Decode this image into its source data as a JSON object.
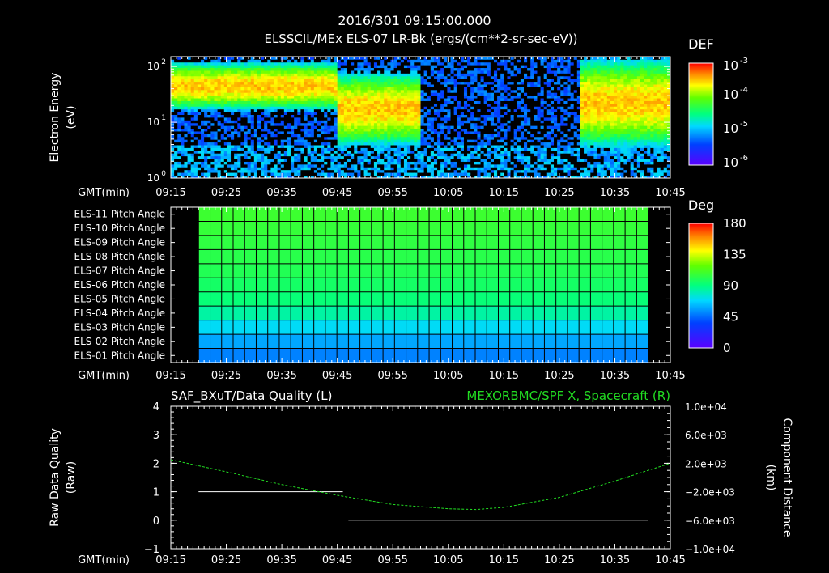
{
  "header": {
    "title": "2016/301 09:15:00.000",
    "subtitle": "ELSSCIL/MEx ELS-07 LR-Bk  (ergs/(cm**2-sr-sec-eV))"
  },
  "colors": {
    "background": "#000000",
    "axes": "#ffffff",
    "quality_line": "#ffffff",
    "spacecraft_line": "#22dd22",
    "right_title": "#22dd22"
  },
  "chart_data": [
    {
      "type": "heatmap",
      "name": "energy-spectrogram",
      "ylabel": "Electron Energy",
      "yunit": "(eV)",
      "xlabel": "GMT(min)",
      "x_ticks": [
        "09:15",
        "09:25",
        "09:35",
        "09:45",
        "09:55",
        "10:05",
        "10:15",
        "10:25",
        "10:35",
        "10:45"
      ],
      "y_scale": "log",
      "ylim": [
        1,
        150
      ],
      "y_ticks": [
        {
          "base": "10",
          "exp": "0",
          "value": 1
        },
        {
          "base": "10",
          "exp": "1",
          "value": 10
        },
        {
          "base": "10",
          "exp": "2",
          "value": 100
        }
      ],
      "colorbar": {
        "label": "DEF",
        "scale": "log",
        "ticks": [
          {
            "base": "10",
            "exp": "-3",
            "value": 0.001
          },
          {
            "base": "10",
            "exp": "-4",
            "value": 0.0001
          },
          {
            "base": "10",
            "exp": "-5",
            "value": 1e-05
          },
          {
            "base": "10",
            "exp": "-6",
            "value": 1e-06
          }
        ]
      },
      "features": [
        {
          "t_start": "09:15",
          "t_end": "09:45",
          "energy_min": 20,
          "energy_max": 100,
          "level": "high"
        },
        {
          "t_start": "09:45",
          "t_end": "10:00",
          "energy_min": 5,
          "energy_max": 60,
          "level": "high"
        },
        {
          "t_start": "10:29",
          "t_end": "10:45",
          "energy_min": 5,
          "energy_max": 100,
          "level": "high"
        }
      ]
    },
    {
      "type": "heatmap",
      "name": "pitch-angle-panel",
      "xlabel": "GMT(min)",
      "x_ticks": [
        "09:15",
        "09:25",
        "09:35",
        "09:45",
        "09:55",
        "10:05",
        "10:15",
        "10:25",
        "10:35",
        "10:45"
      ],
      "rows": [
        "ELS-11 Pitch Angle",
        "ELS-10 Pitch Angle",
        "ELS-09 Pitch Angle",
        "ELS-08 Pitch Angle",
        "ELS-07 Pitch Angle",
        "ELS-06 Pitch Angle",
        "ELS-05 Pitch Angle",
        "ELS-04 Pitch Angle",
        "ELS-03 Pitch Angle",
        "ELS-02 Pitch Angle",
        "ELS-01 Pitch Angle"
      ],
      "row_values": [
        108,
        106,
        104,
        102,
        100,
        96,
        92,
        84,
        70,
        58,
        50
      ],
      "data_start": "09:20",
      "data_end": "10:41",
      "colorbar": {
        "label": "Deg",
        "range": [
          0,
          180
        ],
        "ticks": [
          "180",
          "135",
          "90",
          "45",
          "0"
        ]
      }
    },
    {
      "type": "line",
      "name": "quality-and-spacecraft",
      "left_title": "SAF_BXuT/Data Quality (L)",
      "right_title": "MEXORBMC/SPF X, Spacecraft (R)",
      "ylabel": "Raw Data Quality",
      "yunit": "(Raw)",
      "y2label": "Component Distance",
      "y2unit": "(km)",
      "xlabel": "GMT(min)",
      "x_ticks": [
        "09:15",
        "09:25",
        "09:35",
        "09:45",
        "09:55",
        "10:05",
        "10:15",
        "10:25",
        "10:35",
        "10:45"
      ],
      "ylim": [
        -1,
        4
      ],
      "y_ticks": [
        "4",
        "3",
        "2",
        "1",
        "0",
        "−1"
      ],
      "y2lim": [
        -10000,
        10000
      ],
      "y2_ticks": [
        "1.0e+04",
        "6.0e+03",
        "2.0e+03",
        "−2.0e+03",
        "−6.0e+03",
        "−1.0e+04"
      ],
      "series": [
        {
          "axis": "left",
          "segments": [
            {
              "x_start": "09:20",
              "x_end": "09:46",
              "y": 1
            },
            {
              "x_start": "09:47",
              "x_end": "10:41",
              "y": 0
            }
          ]
        },
        {
          "axis": "right",
          "x": [
            "09:15",
            "09:25",
            "09:35",
            "09:45",
            "09:55",
            "10:05",
            "10:10",
            "10:15",
            "10:25",
            "10:35",
            "10:45"
          ],
          "y": [
            2500,
            800,
            -1000,
            -2500,
            -3800,
            -4400,
            -4500,
            -4200,
            -2800,
            -500,
            2000
          ]
        }
      ]
    }
  ]
}
